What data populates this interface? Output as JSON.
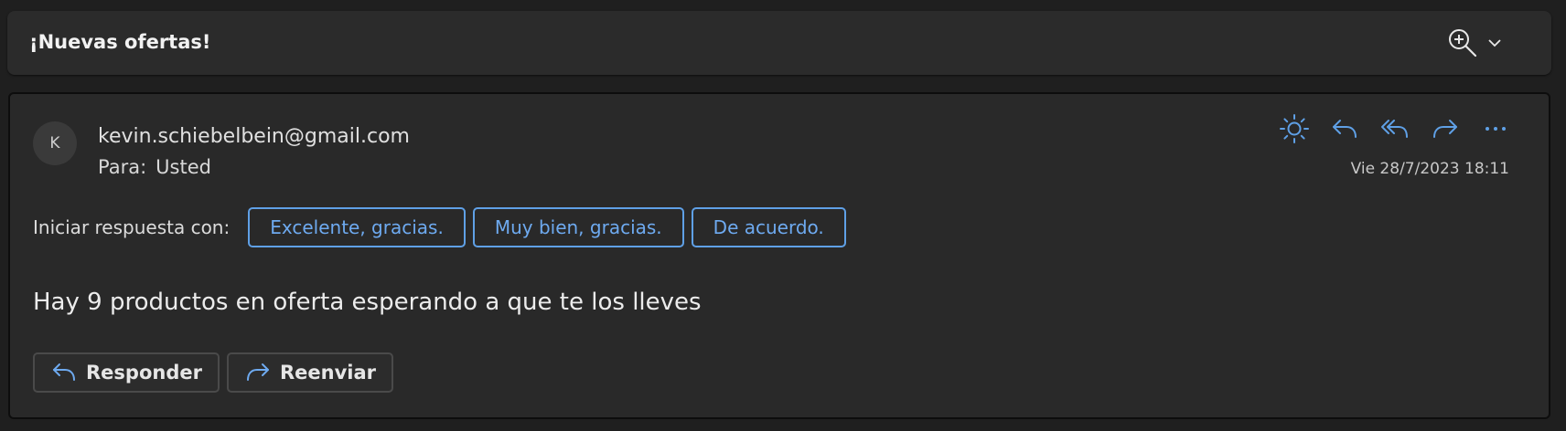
{
  "subject": {
    "title": "¡Nuevas ofertas!",
    "zoom_icon": "zoom-in-icon",
    "dropdown_icon": "chevron-down-icon"
  },
  "message": {
    "avatar_initial": "K",
    "sender": "kevin.schiebelbein@gmail.com",
    "to_label": "Para:",
    "to_value": "Usted",
    "date": "Vie 28/7/2023 18:11",
    "actions": [
      {
        "name": "sun-icon"
      },
      {
        "name": "reply-icon"
      },
      {
        "name": "reply-all-icon"
      },
      {
        "name": "forward-icon"
      },
      {
        "name": "more-icon"
      }
    ],
    "quick_reply": {
      "label": "Iniciar respuesta con:",
      "options": [
        "Excelente, gracias.",
        "Muy bien, gracias.",
        "De acuerdo."
      ]
    },
    "body": "Hay 9 productos en oferta esperando a que te los lleves",
    "buttons": {
      "reply": "Responder",
      "forward": "Reenviar"
    }
  },
  "colors": {
    "accent": "#5fa0e6",
    "background": "#1f1f1f",
    "card": "#292929"
  }
}
